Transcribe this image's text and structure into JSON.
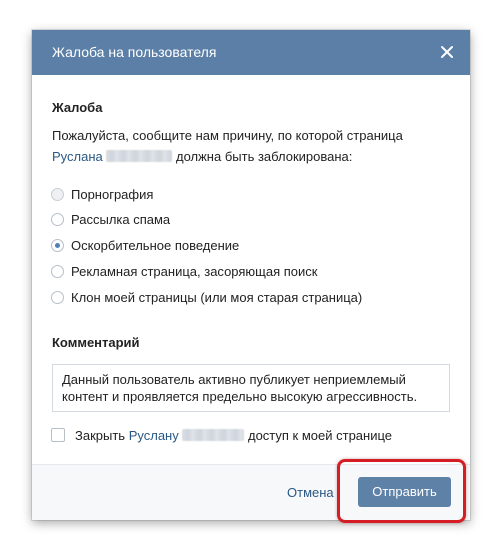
{
  "dialog": {
    "title": "Жалоба на пользователя",
    "header_color": "#5b7fa6",
    "close_icon": "close-icon"
  },
  "complaint": {
    "heading": "Жалоба",
    "prompt_line1": "Пожалуйста, сообщите нам причину, по которой страница",
    "user_name": "Руслана",
    "prompt_line2_suffix": "должна быть заблокирована:",
    "options": [
      {
        "label": "Порнография",
        "state": "disabled"
      },
      {
        "label": "Рассылка спама",
        "state": "unchecked"
      },
      {
        "label": "Оскорбительное поведение",
        "state": "checked"
      },
      {
        "label": "Рекламная страница, засоряющая поиск",
        "state": "unchecked"
      },
      {
        "label": "Клон моей страницы (или моя старая страница)",
        "state": "unchecked"
      }
    ]
  },
  "comment": {
    "heading": "Комментарий",
    "value": "Данный пользователь активно публикует неприемлемый контент и проявляется предельно высокую агрессивность."
  },
  "block_access": {
    "prefix": "Закрыть",
    "user_name": "Руслану",
    "suffix": "доступ к моей странице",
    "checked": false
  },
  "footer": {
    "cancel_label": "Отмена",
    "send_label": "Отправить"
  },
  "colors": {
    "accent": "#5181b8",
    "link": "#2a5885",
    "button": "#5e81a8",
    "highlight": "#d51d25"
  }
}
